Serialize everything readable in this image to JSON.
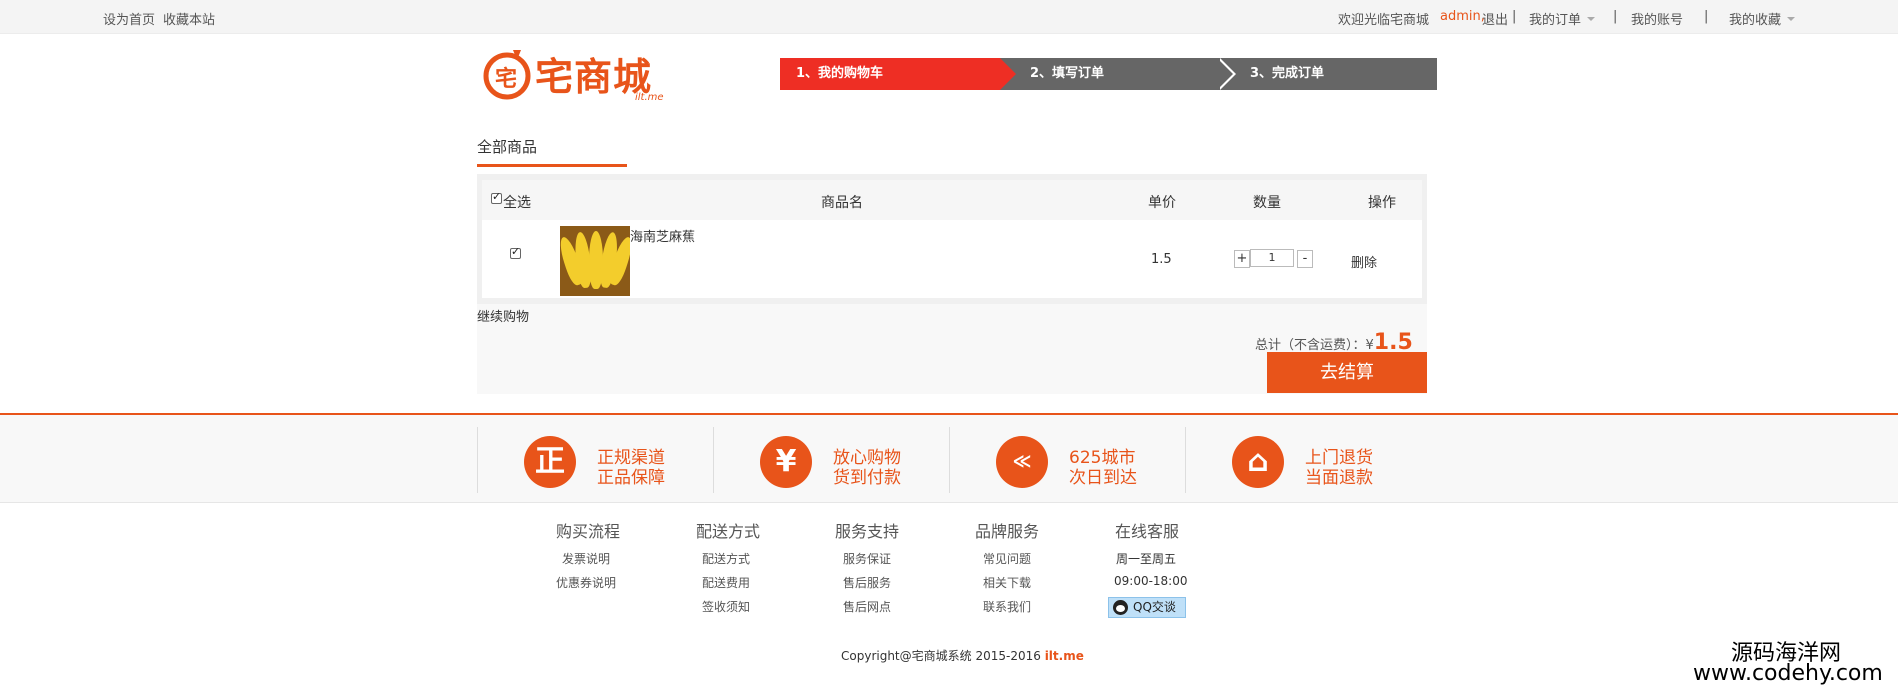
{
  "topbar": {
    "set_home": "设为首页",
    "bookmark": "收藏本站",
    "welcome": "欢迎光临宅商城",
    "username": "admin,",
    "logout": "退出",
    "pipe": "|",
    "my_orders": "我的订单",
    "my_account": "我的账号",
    "my_favorites": "我的收藏"
  },
  "logo": {
    "text": "宅商城",
    "sub": "ilt.me",
    "mark": "宅"
  },
  "steps": [
    "1、我的购物车",
    "2、填写订单",
    "3、完成订单"
  ],
  "tab": {
    "label": "全部商品"
  },
  "cart": {
    "headers": {
      "select_all": "全选",
      "name": "商品名",
      "price": "单价",
      "qty": "数量",
      "action": "操作"
    },
    "items": [
      {
        "name": "海南芝麻蕉",
        "price": "1.5",
        "qty": "1",
        "delete": "删除",
        "qty_plus": "+",
        "qty_minus": "-"
      }
    ],
    "continue": "继续购物",
    "total_label": "总计（不含运费）：¥",
    "total_value": "1.5",
    "checkout": "去结算"
  },
  "features": [
    {
      "icon": "正",
      "icon_name": "genuine-icon",
      "line1": "正规渠道",
      "line2": "正品保障"
    },
    {
      "icon": "¥",
      "icon_name": "yen-icon",
      "line1": "放心购物",
      "line2": "货到付款"
    },
    {
      "icon": "≪",
      "icon_name": "delivery-truck-icon",
      "line1": "625城市",
      "line2": "次日到达"
    },
    {
      "icon": "⌂",
      "icon_name": "return-basket-icon",
      "line1": "上门退货",
      "line2": "当面退款"
    }
  ],
  "footer_cols": [
    {
      "title": "购买流程",
      "links": [
        "发票说明",
        "优惠券说明"
      ]
    },
    {
      "title": "配送方式",
      "links": [
        "配送方式",
        "配送费用",
        "签收须知"
      ]
    },
    {
      "title": "服务支持",
      "links": [
        "服务保证",
        "售后服务",
        "售后网点"
      ]
    },
    {
      "title": "品牌服务",
      "links": [
        "常见问题",
        "相关下载",
        "联系我们"
      ]
    },
    {
      "title": "在线客服",
      "links": [
        "周一至周五",
        "09:00-18:00"
      ],
      "qq": "QQ交谈"
    }
  ],
  "copyright": {
    "text": "Copyright@宅商城系统 2015-2016 ",
    "brand": "ilt.me"
  },
  "watermark": {
    "line1": "源码海洋网",
    "line2": "www.codehy.com"
  },
  "colors": {
    "accent": "#e8541a",
    "step_active": "#ee2e24",
    "step_inactive": "#666666"
  }
}
